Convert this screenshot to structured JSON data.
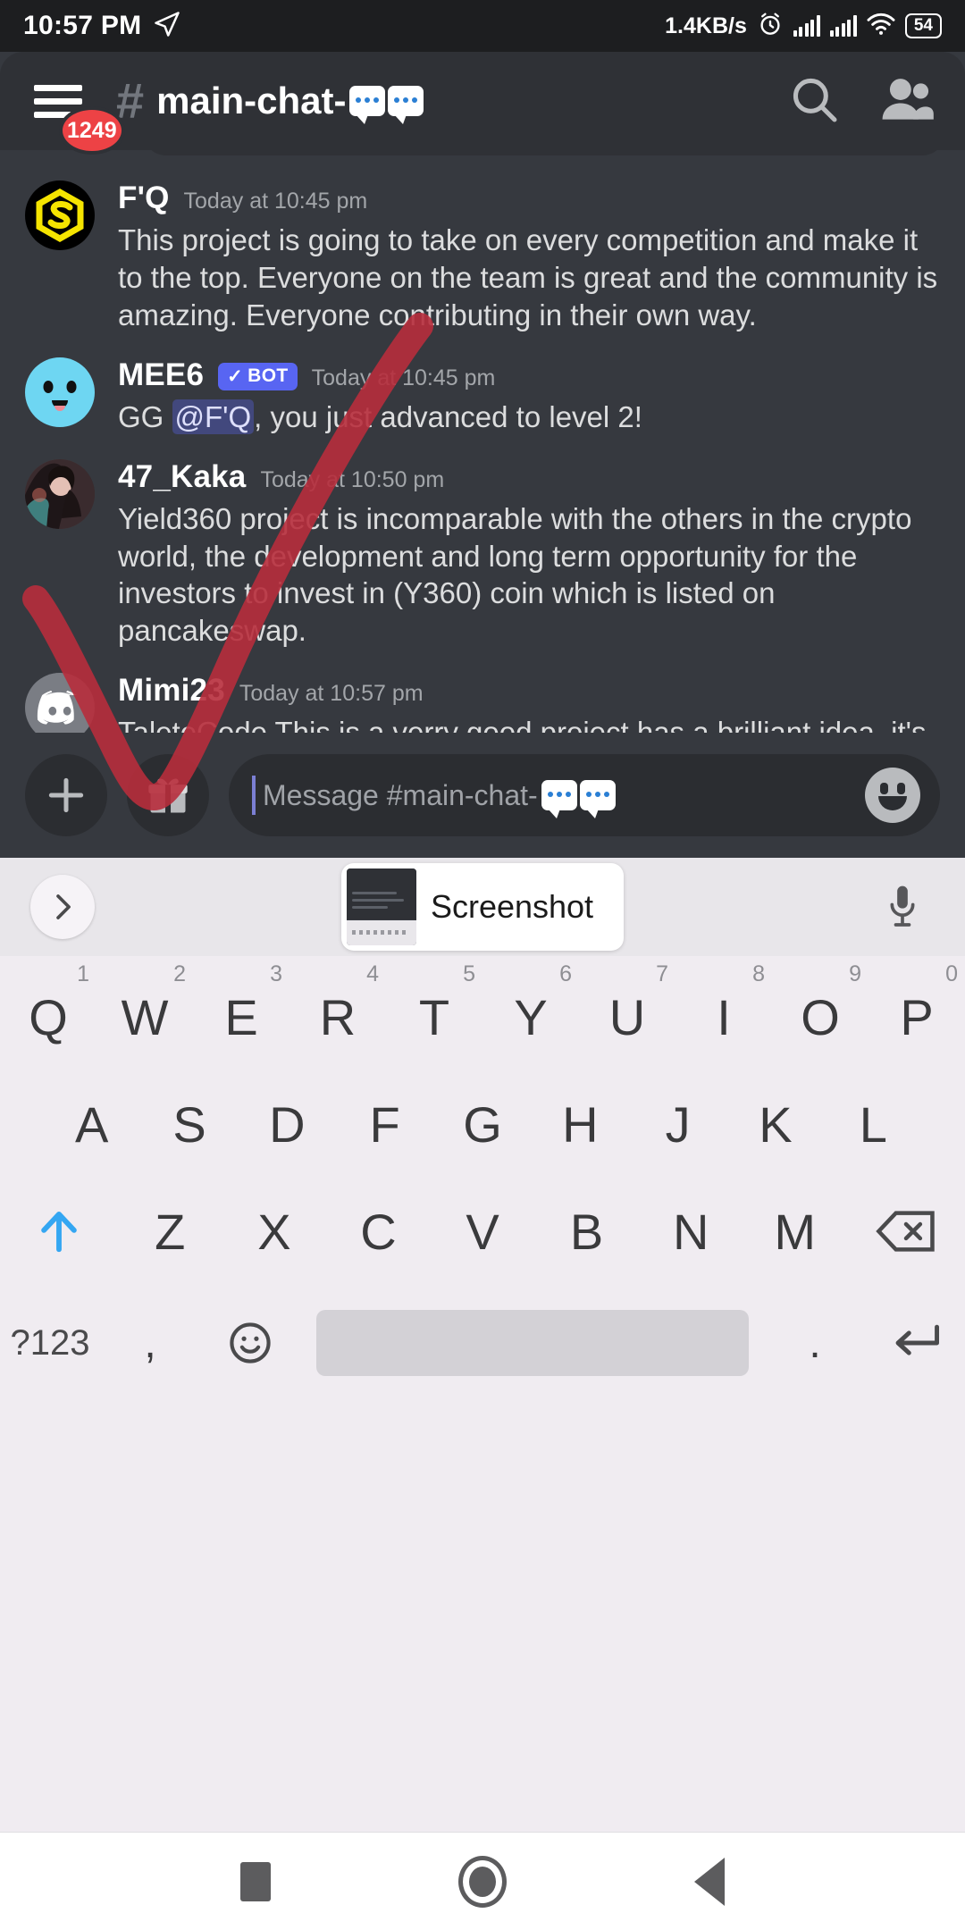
{
  "status_bar": {
    "clock": "10:57 PM",
    "location_icon": "navigation-arrow-icon",
    "network_speed": "1.4KB/s",
    "alarm_icon": "alarm-clock-icon",
    "signal_icon_1": "cellular-signal-icon",
    "signal_icon_2": "cellular-signal-icon",
    "wifi_icon": "wifi-icon",
    "battery_level": "54"
  },
  "header": {
    "menu_icon": "hamburger-menu-icon",
    "unread_badge": "1249",
    "hash_icon": "hash-icon",
    "channel_name": "main-chat-",
    "search_icon": "search-icon",
    "members_icon": "members-icon"
  },
  "messages": [
    {
      "author": "F'Q",
      "timestamp": "Today at 10:45 pm",
      "avatar": "s-hexagon-logo-avatar",
      "is_bot": false,
      "text": "This project is going to take on every competition and make it to the top. Everyone on the team is great and the community is amazing. Everyone contributing in their own way."
    },
    {
      "author": "MEE6",
      "timestamp": "Today at 10:45 pm",
      "avatar": "mee6-blue-face-avatar",
      "is_bot": true,
      "bot_tag": "BOT",
      "text_before": "GG ",
      "mention": "@F'Q",
      "text_after": ", you just advanced to level 2!"
    },
    {
      "author": "47_Kaka",
      "timestamp": "Today at 10:50 pm",
      "avatar": "photo-portrait-avatar",
      "is_bot": false,
      "text": "Yield360 project is incomparable with the others in the crypto world, the development and long term opportunity for the investors to invest in (Y360) coin which is listed on pancakeswap."
    },
    {
      "author": "Mimi23",
      "timestamp": "Today at 10:57 pm",
      "avatar": "discord-default-avatar",
      "is_bot": false,
      "text": "TaleteCode This is a verry good project has a brilliant idea, it's great that such an industry is developing,really a very good project because it will help many people"
    }
  ],
  "input_bar": {
    "add_icon": "plus-icon",
    "gift_icon": "gift-icon",
    "placeholder": "Message #main-chat-",
    "emoji_icon": "smiley-face-icon"
  },
  "suggestion_strip": {
    "expand_icon": "chevron-right-icon",
    "clipboard_label": "Screenshot",
    "thumbnail_icon": "screenshot-thumbnail",
    "mic_icon": "microphone-icon"
  },
  "keyboard": {
    "row1": [
      {
        "letter": "Q",
        "num": "1"
      },
      {
        "letter": "W",
        "num": "2"
      },
      {
        "letter": "E",
        "num": "3"
      },
      {
        "letter": "R",
        "num": "4"
      },
      {
        "letter": "T",
        "num": "5"
      },
      {
        "letter": "Y",
        "num": "6"
      },
      {
        "letter": "U",
        "num": "7"
      },
      {
        "letter": "I",
        "num": "8"
      },
      {
        "letter": "O",
        "num": "9"
      },
      {
        "letter": "P",
        "num": "0"
      }
    ],
    "row2": [
      "A",
      "S",
      "D",
      "F",
      "G",
      "H",
      "J",
      "K",
      "L"
    ],
    "row3": {
      "shift_icon": "shift-arrow-icon",
      "letters": [
        "Z",
        "X",
        "C",
        "V",
        "B",
        "N",
        "M"
      ],
      "backspace_icon": "backspace-icon"
    },
    "row4": {
      "symbols_key": "?123",
      "comma": ",",
      "emoji_icon": "emoji-smiley-icon",
      "space": "",
      "period": ".",
      "enter_icon": "enter-arrow-icon"
    }
  },
  "nav_bar": {
    "recents_icon": "recents-square-icon",
    "home_icon": "home-circle-icon",
    "back_icon": "back-triangle-icon"
  },
  "annotation": {
    "type": "handwritten-checkmark",
    "color": "#b72d3c"
  },
  "colors": {
    "chat_bg": "#36393f",
    "header_bg": "#2f3136",
    "accent_blurple": "#5865f2",
    "badge_red": "#ed4245",
    "keyboard_bg": "#f0ecf1"
  }
}
